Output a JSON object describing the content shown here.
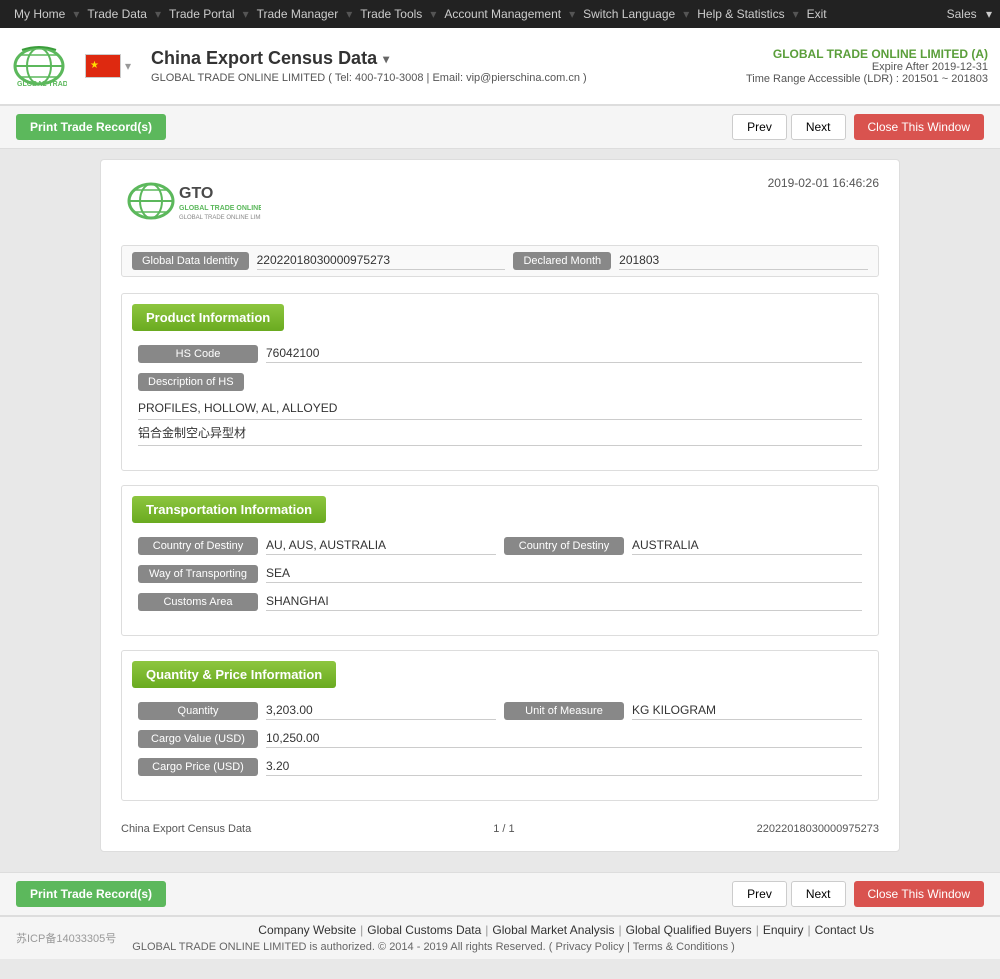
{
  "topnav": {
    "items": [
      "My Home",
      "Trade Data",
      "Trade Portal",
      "Trade Manager",
      "Trade Tools",
      "Account Management",
      "Switch Language",
      "Help & Statistics",
      "Exit"
    ],
    "right": "Sales"
  },
  "header": {
    "title": "China Export Census Data",
    "flag_label": "China Flag",
    "company": "GLOBAL TRADE ONLINE LIMITED ( Tel: 400-710-3008 | Email: vip@pierschina.com.cn )",
    "company_link": "GLOBAL TRADE ONLINE LIMITED (A)",
    "expire": "Expire After 2019-12-31",
    "ldr": "Time Range Accessible (LDR) : 201501 ~ 201803"
  },
  "toolbar": {
    "print_label": "Print Trade Record(s)",
    "prev_label": "Prev",
    "next_label": "Next",
    "close_label": "Close This Window"
  },
  "record": {
    "timestamp": "2019-02-01 16:46:26",
    "global_data_identity_label": "Global Data Identity",
    "global_data_identity_value": "22022018030000975273",
    "declared_month_label": "Declared Month",
    "declared_month_value": "201803",
    "sections": {
      "product": {
        "title": "Product Information",
        "hs_code_label": "HS Code",
        "hs_code_value": "76042100",
        "description_label": "Description of HS",
        "description_en": "PROFILES, HOLLOW, AL, ALLOYED",
        "description_cn": "铝合金制空心异型材"
      },
      "transportation": {
        "title": "Transportation Information",
        "country_dest_label": "Country of Destiny",
        "country_dest_value": "AU, AUS, AUSTRALIA",
        "country_dest2_label": "Country of Destiny",
        "country_dest2_value": "AUSTRALIA",
        "way_label": "Way of Transporting",
        "way_value": "SEA",
        "customs_label": "Customs Area",
        "customs_value": "SHANGHAI"
      },
      "quantity": {
        "title": "Quantity & Price Information",
        "quantity_label": "Quantity",
        "quantity_value": "3,203.00",
        "unit_label": "Unit of Measure",
        "unit_value": "KG KILOGRAM",
        "cargo_value_label": "Cargo Value (USD)",
        "cargo_value": "10,250.00",
        "cargo_price_label": "Cargo Price (USD)",
        "cargo_price": "3.20"
      }
    },
    "footer": {
      "left": "China Export Census Data",
      "center": "1 / 1",
      "right": "22022018030000975273"
    }
  },
  "footer": {
    "icp": "苏ICP备14033305号",
    "links": [
      "Company Website",
      "Global Customs Data",
      "Global Market Analysis",
      "Global Qualified Buyers",
      "Enquiry",
      "Contact Us"
    ],
    "copyright": "GLOBAL TRADE ONLINE LIMITED is authorized. © 2014 - 2019 All rights Reserved.  (  Privacy Policy  |  Terms & Conditions  )"
  }
}
